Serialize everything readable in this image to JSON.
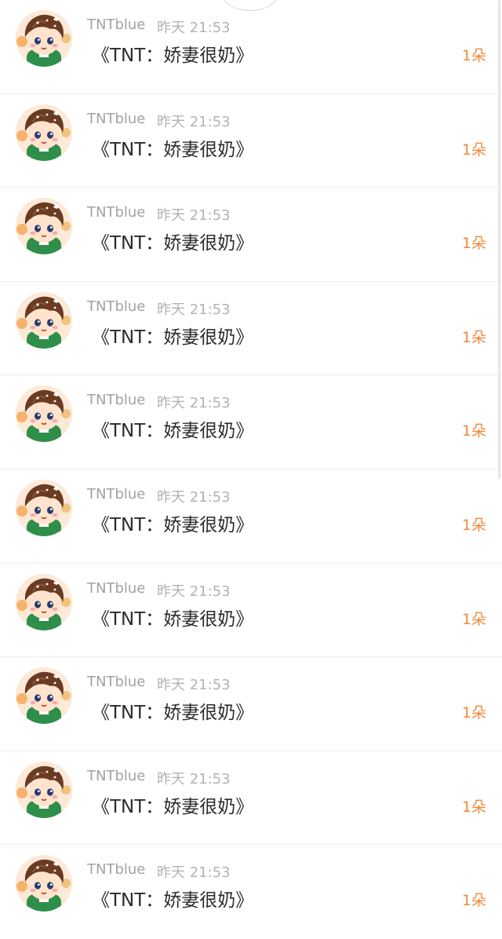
{
  "colors": {
    "username": "#a2a2a2",
    "time": "#b3b3b3",
    "gift_name": "#2b2b2b",
    "gift_count": "#f08a3b",
    "divider": "#efefef"
  },
  "rows": [
    {
      "avatar": "cartoon-boy-avatar",
      "username": "TNTblue",
      "time": "昨天 21:53",
      "gift_name": "《TNT：娇妻很奶》",
      "count": "1朵"
    },
    {
      "avatar": "cartoon-boy-avatar",
      "username": "TNTblue",
      "time": "昨天 21:53",
      "gift_name": "《TNT：娇妻很奶》",
      "count": "1朵"
    },
    {
      "avatar": "cartoon-boy-avatar",
      "username": "TNTblue",
      "time": "昨天 21:53",
      "gift_name": "《TNT：娇妻很奶》",
      "count": "1朵"
    },
    {
      "avatar": "cartoon-boy-avatar",
      "username": "TNTblue",
      "time": "昨天 21:53",
      "gift_name": "《TNT：娇妻很奶》",
      "count": "1朵"
    },
    {
      "avatar": "cartoon-boy-avatar",
      "username": "TNTblue",
      "time": "昨天 21:53",
      "gift_name": "《TNT：娇妻很奶》",
      "count": "1朵"
    },
    {
      "avatar": "cartoon-boy-avatar",
      "username": "TNTblue",
      "time": "昨天 21:53",
      "gift_name": "《TNT：娇妻很奶》",
      "count": "1朵"
    },
    {
      "avatar": "cartoon-boy-avatar",
      "username": "TNTblue",
      "time": "昨天 21:53",
      "gift_name": "《TNT：娇妻很奶》",
      "count": "1朵"
    },
    {
      "avatar": "cartoon-boy-avatar",
      "username": "TNTblue",
      "time": "昨天 21:53",
      "gift_name": "《TNT：娇妻很奶》",
      "count": "1朵"
    },
    {
      "avatar": "cartoon-boy-avatar",
      "username": "TNTblue",
      "time": "昨天 21:53",
      "gift_name": "《TNT：娇妻很奶》",
      "count": "1朵"
    },
    {
      "avatar": "cartoon-boy-avatar",
      "username": "TNTblue",
      "time": "昨天 21:53",
      "gift_name": "《TNT：娇妻很奶》",
      "count": "1朵"
    }
  ]
}
